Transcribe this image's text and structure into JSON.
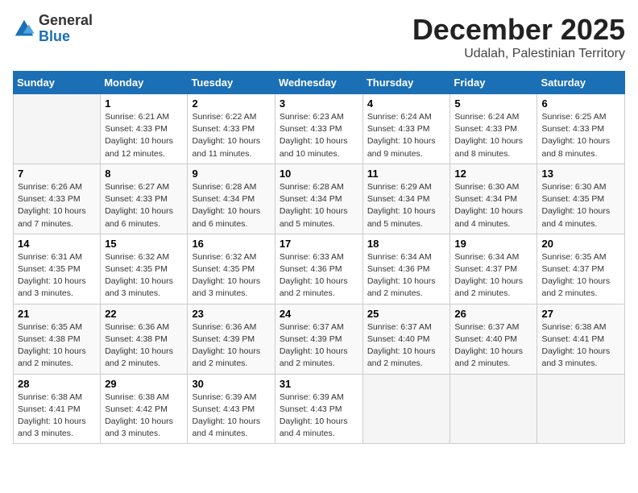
{
  "logo": {
    "general": "General",
    "blue": "Blue"
  },
  "header": {
    "month": "December 2025",
    "location": "Udalah, Palestinian Territory"
  },
  "days_of_week": [
    "Sunday",
    "Monday",
    "Tuesday",
    "Wednesday",
    "Thursday",
    "Friday",
    "Saturday"
  ],
  "weeks": [
    [
      {
        "day": "",
        "info": ""
      },
      {
        "day": "1",
        "info": "Sunrise: 6:21 AM\nSunset: 4:33 PM\nDaylight: 10 hours\nand 12 minutes."
      },
      {
        "day": "2",
        "info": "Sunrise: 6:22 AM\nSunset: 4:33 PM\nDaylight: 10 hours\nand 11 minutes."
      },
      {
        "day": "3",
        "info": "Sunrise: 6:23 AM\nSunset: 4:33 PM\nDaylight: 10 hours\nand 10 minutes."
      },
      {
        "day": "4",
        "info": "Sunrise: 6:24 AM\nSunset: 4:33 PM\nDaylight: 10 hours\nand 9 minutes."
      },
      {
        "day": "5",
        "info": "Sunrise: 6:24 AM\nSunset: 4:33 PM\nDaylight: 10 hours\nand 8 minutes."
      },
      {
        "day": "6",
        "info": "Sunrise: 6:25 AM\nSunset: 4:33 PM\nDaylight: 10 hours\nand 8 minutes."
      }
    ],
    [
      {
        "day": "7",
        "info": "Sunrise: 6:26 AM\nSunset: 4:33 PM\nDaylight: 10 hours\nand 7 minutes."
      },
      {
        "day": "8",
        "info": "Sunrise: 6:27 AM\nSunset: 4:33 PM\nDaylight: 10 hours\nand 6 minutes."
      },
      {
        "day": "9",
        "info": "Sunrise: 6:28 AM\nSunset: 4:34 PM\nDaylight: 10 hours\nand 6 minutes."
      },
      {
        "day": "10",
        "info": "Sunrise: 6:28 AM\nSunset: 4:34 PM\nDaylight: 10 hours\nand 5 minutes."
      },
      {
        "day": "11",
        "info": "Sunrise: 6:29 AM\nSunset: 4:34 PM\nDaylight: 10 hours\nand 5 minutes."
      },
      {
        "day": "12",
        "info": "Sunrise: 6:30 AM\nSunset: 4:34 PM\nDaylight: 10 hours\nand 4 minutes."
      },
      {
        "day": "13",
        "info": "Sunrise: 6:30 AM\nSunset: 4:35 PM\nDaylight: 10 hours\nand 4 minutes."
      }
    ],
    [
      {
        "day": "14",
        "info": "Sunrise: 6:31 AM\nSunset: 4:35 PM\nDaylight: 10 hours\nand 3 minutes."
      },
      {
        "day": "15",
        "info": "Sunrise: 6:32 AM\nSunset: 4:35 PM\nDaylight: 10 hours\nand 3 minutes."
      },
      {
        "day": "16",
        "info": "Sunrise: 6:32 AM\nSunset: 4:35 PM\nDaylight: 10 hours\nand 3 minutes."
      },
      {
        "day": "17",
        "info": "Sunrise: 6:33 AM\nSunset: 4:36 PM\nDaylight: 10 hours\nand 2 minutes."
      },
      {
        "day": "18",
        "info": "Sunrise: 6:34 AM\nSunset: 4:36 PM\nDaylight: 10 hours\nand 2 minutes."
      },
      {
        "day": "19",
        "info": "Sunrise: 6:34 AM\nSunset: 4:37 PM\nDaylight: 10 hours\nand 2 minutes."
      },
      {
        "day": "20",
        "info": "Sunrise: 6:35 AM\nSunset: 4:37 PM\nDaylight: 10 hours\nand 2 minutes."
      }
    ],
    [
      {
        "day": "21",
        "info": "Sunrise: 6:35 AM\nSunset: 4:38 PM\nDaylight: 10 hours\nand 2 minutes."
      },
      {
        "day": "22",
        "info": "Sunrise: 6:36 AM\nSunset: 4:38 PM\nDaylight: 10 hours\nand 2 minutes."
      },
      {
        "day": "23",
        "info": "Sunrise: 6:36 AM\nSunset: 4:39 PM\nDaylight: 10 hours\nand 2 minutes."
      },
      {
        "day": "24",
        "info": "Sunrise: 6:37 AM\nSunset: 4:39 PM\nDaylight: 10 hours\nand 2 minutes."
      },
      {
        "day": "25",
        "info": "Sunrise: 6:37 AM\nSunset: 4:40 PM\nDaylight: 10 hours\nand 2 minutes."
      },
      {
        "day": "26",
        "info": "Sunrise: 6:37 AM\nSunset: 4:40 PM\nDaylight: 10 hours\nand 2 minutes."
      },
      {
        "day": "27",
        "info": "Sunrise: 6:38 AM\nSunset: 4:41 PM\nDaylight: 10 hours\nand 3 minutes."
      }
    ],
    [
      {
        "day": "28",
        "info": "Sunrise: 6:38 AM\nSunset: 4:41 PM\nDaylight: 10 hours\nand 3 minutes."
      },
      {
        "day": "29",
        "info": "Sunrise: 6:38 AM\nSunset: 4:42 PM\nDaylight: 10 hours\nand 3 minutes."
      },
      {
        "day": "30",
        "info": "Sunrise: 6:39 AM\nSunset: 4:43 PM\nDaylight: 10 hours\nand 4 minutes."
      },
      {
        "day": "31",
        "info": "Sunrise: 6:39 AM\nSunset: 4:43 PM\nDaylight: 10 hours\nand 4 minutes."
      },
      {
        "day": "",
        "info": ""
      },
      {
        "day": "",
        "info": ""
      },
      {
        "day": "",
        "info": ""
      }
    ]
  ]
}
